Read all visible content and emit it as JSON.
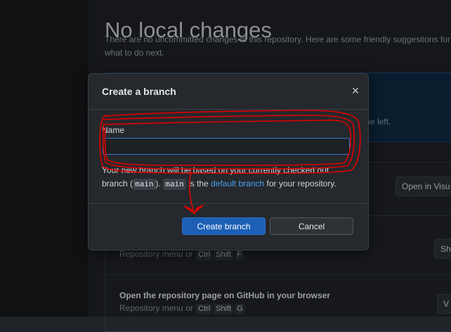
{
  "background": {
    "title": "No local changes",
    "subtitle": "There are no uncommitted changes in this repository. Here are some friendly suggestions for what to do next.",
    "blue_card_hint": "the left.",
    "open_button": "Open in Visu",
    "show_button": "Sh",
    "view_button": "V",
    "row2_hint_prefix": "Repository menu or",
    "row2_keys": [
      "Ctrl",
      "Shift",
      "F"
    ],
    "row3_title": "Open the repository page on GitHub in your browser",
    "row3_hint_prefix": "Repository menu or",
    "row3_keys": [
      "Ctrl",
      "Shift",
      "G"
    ]
  },
  "dialog": {
    "title": "Create a branch",
    "close_symbol": "×",
    "name_label": "Name",
    "name_value": "",
    "desc_part1": "Your new branch will be based on your currently checked out branch (",
    "branch_code": "main",
    "desc_part2": ").",
    "branch_code2": "main",
    "desc_part3": "is the",
    "default_branch_link": "default branch",
    "desc_part4": "for your repository.",
    "create_button": "Create branch",
    "cancel_button": "Cancel"
  },
  "colors": {
    "accent": "#1c5fb5",
    "link": "#4aa0f0",
    "annotation": "#e00000"
  }
}
